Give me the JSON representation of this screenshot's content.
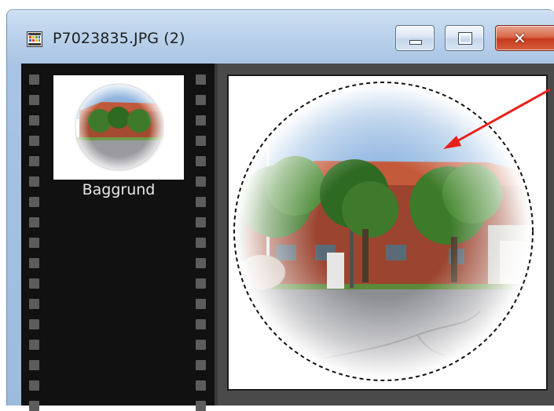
{
  "window": {
    "title": "P7023835.JPG (2)",
    "app_icon": "image-file-icon",
    "caption_buttons": {
      "minimize": "minimize-icon",
      "maximize": "maximize-icon",
      "close_glyph": "✕"
    }
  },
  "layers_panel": {
    "layers": [
      {
        "name": "Baggrund",
        "thumbnail": "layer-thumbnail"
      }
    ]
  },
  "canvas": {
    "content": "photo-with-circular-vignette-selection"
  },
  "annotation": {
    "type": "arrow",
    "color": "#e8201c"
  },
  "colors": {
    "titlebar": "#b7cfea",
    "close_button": "#c43b1c",
    "panel_background": "#111111",
    "canvas_background": "#4a4a4a"
  }
}
